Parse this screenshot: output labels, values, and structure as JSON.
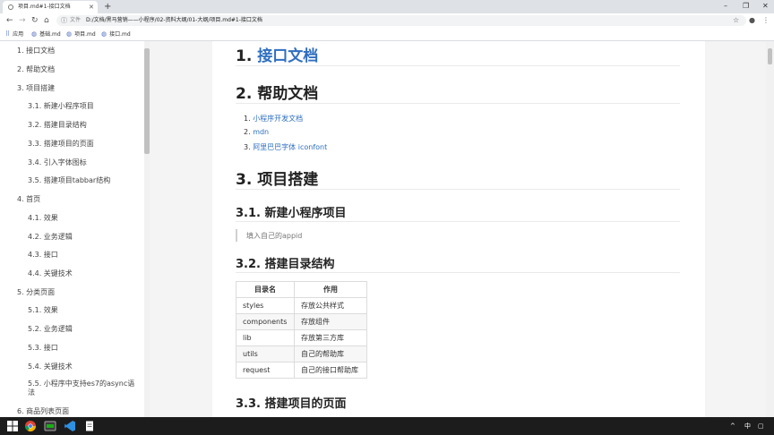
{
  "browser": {
    "tab_title": "项目.md#1-接口文档",
    "url_scheme": "文件",
    "url": "D:/文档/黑马营销——小程序/02-资料大纲/01-大纲/项目.md#1-接口文档",
    "bookmarks": [
      "应用",
      "基础.md",
      "项目.md",
      "接口.md"
    ]
  },
  "sidebar": {
    "items": [
      "1. 接口文档",
      "2. 帮助文档",
      "3. 项目搭建",
      "3.1. 新建小程序项目",
      "3.2. 搭建目录结构",
      "3.3. 搭建项目的页面",
      "3.4. 引入字体图标",
      "3.5. 搭建项目tabbar结构",
      "4. 首页",
      "4.1. 效果",
      "4.2. 业务逻辑",
      "4.3. 接口",
      "4.4. 关键技术",
      "5. 分类页面",
      "5.1. 效果",
      "5.2. 业务逻辑",
      "5.3. 接口",
      "5.4. 关键技术",
      "5.5. 小程序中支持es7的async语法",
      "6. 商品列表页面"
    ]
  },
  "content": {
    "h1_1_num": "1.",
    "h1_1_link": "接口文档",
    "h1_2": "2. 帮助文档",
    "help_links": [
      "小程序开发文档",
      "mdn",
      "阿里巴巴字体 iconfont"
    ],
    "h1_3": "3. 项目搭建",
    "h2_31": "3.1. 新建小程序项目",
    "quote": "填入自己的appid",
    "h2_32": "3.2. 搭建目录结构",
    "table": {
      "headers": [
        "目录名",
        "作用"
      ],
      "rows": [
        [
          "styles",
          "存放公共样式"
        ],
        [
          "components",
          "存放组件"
        ],
        [
          "lib",
          "存放第三方库"
        ],
        [
          "utils",
          "自己的帮助库"
        ],
        [
          "request",
          "自己的接口帮助库"
        ]
      ]
    },
    "h2_33": "3.3. 搭建项目的页面"
  },
  "taskbar": {
    "tray_lang": "中"
  },
  "colors": {
    "link": "#2f6fc0",
    "taskbar": "#1c1c1c"
  }
}
